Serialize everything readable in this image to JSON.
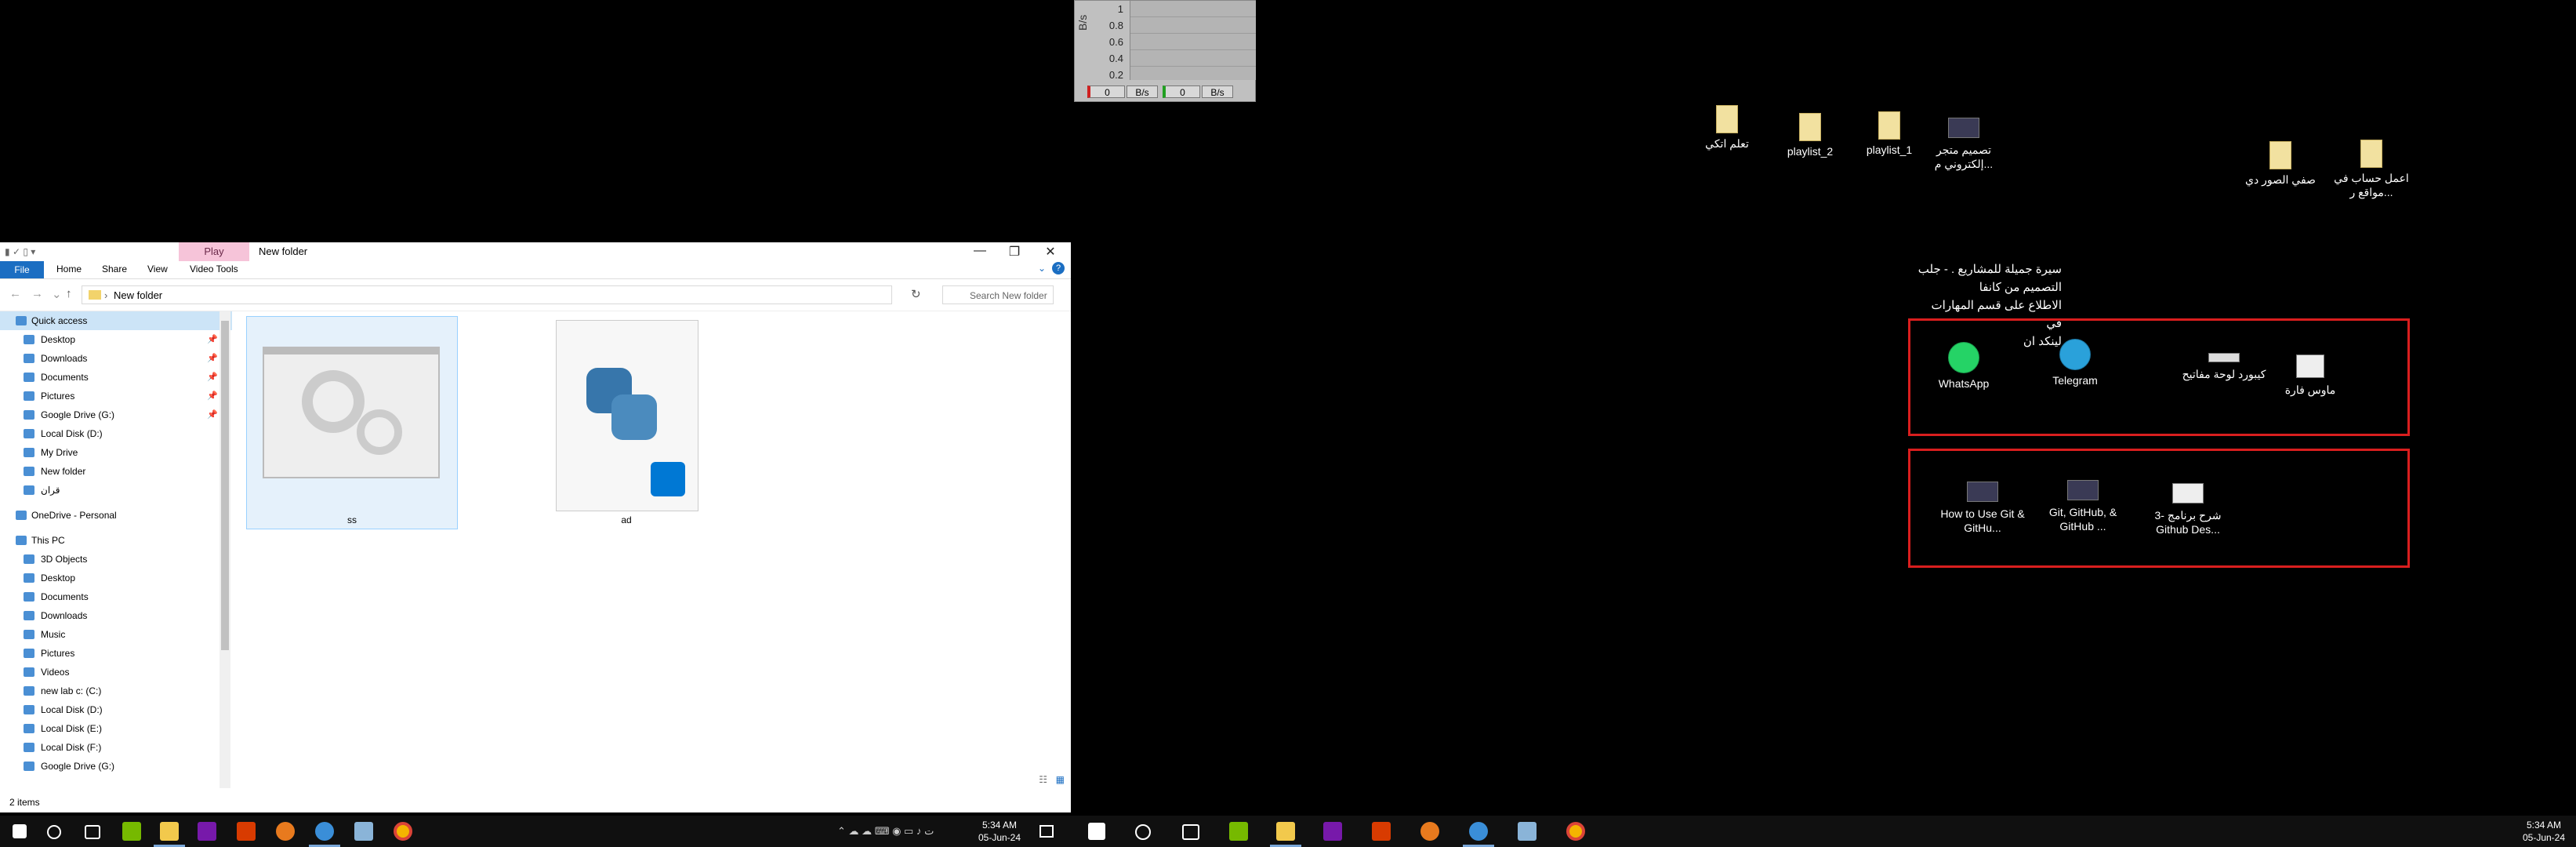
{
  "meter": {
    "unit": "B/s",
    "ticks": [
      "1",
      "0.8",
      "0.6",
      "0.4",
      "0.2"
    ],
    "down_value": "0",
    "down_unit": "B/s",
    "up_value": "0",
    "up_unit": "B/s"
  },
  "desktop_icons": [
    {
      "label": "تعلم اتكي",
      "icon": "folder-zip-icon"
    },
    {
      "label": "playlist_2",
      "icon": "folder-icon"
    },
    {
      "label": "playlist_1",
      "icon": "folder-icon"
    },
    {
      "label": "تصميم متجر إلكتروني م...",
      "icon": "image-icon"
    },
    {
      "label": "صفي الصور دي",
      "icon": "folder-zip-icon"
    },
    {
      "label": "اعمل حساب في مواقع ر...",
      "icon": "folder-zip-icon"
    }
  ],
  "desktop_note": {
    "lines": [
      "سيرة جميلة للمشاريع . - جلب",
      "التصميم من كانفا",
      "الاطلاع على قسم المهارات في",
      "لينكد ان"
    ]
  },
  "box1_icons": [
    {
      "label": "WhatsApp",
      "icon": "whatsapp-icon",
      "color": "#25d366"
    },
    {
      "label": "Telegram",
      "icon": "telegram-icon",
      "color": "#2aa1da"
    },
    {
      "label": "كيبورد لوحة مفاتيح",
      "icon": "keyboard-image-icon"
    },
    {
      "label": "ماوس فارة",
      "icon": "mouse-image-icon"
    }
  ],
  "box2_icons": [
    {
      "label": "How to Use Git & GitHu...",
      "icon": "video-thumb-icon"
    },
    {
      "label": "Git, GitHub, & GitHub ...",
      "icon": "video-thumb-icon"
    },
    {
      "label": "شرح برنامج -3 Github Des...",
      "icon": "video-thumb-icon"
    }
  ],
  "explorer": {
    "title": "New folder",
    "context_tab": "Play",
    "ribbon_tabs": [
      "File",
      "Home",
      "Share",
      "View",
      "Video Tools"
    ],
    "path": "New folder",
    "search_placeholder": "Search New folder",
    "nav": [
      {
        "label": "Quick access",
        "top": true,
        "sel": true
      },
      {
        "label": "Desktop",
        "pin": true
      },
      {
        "label": "Downloads",
        "pin": true
      },
      {
        "label": "Documents",
        "pin": true
      },
      {
        "label": "Pictures",
        "pin": true
      },
      {
        "label": "Google Drive (G:)",
        "pin": true
      },
      {
        "label": "Local Disk (D:)"
      },
      {
        "label": "My Drive"
      },
      {
        "label": "New folder"
      },
      {
        "label": "قران"
      },
      {
        "label": "OneDrive - Personal",
        "top": true
      },
      {
        "label": "This PC",
        "top": true
      },
      {
        "label": "3D Objects"
      },
      {
        "label": "Desktop"
      },
      {
        "label": "Documents"
      },
      {
        "label": "Downloads"
      },
      {
        "label": "Music"
      },
      {
        "label": "Pictures"
      },
      {
        "label": "Videos"
      },
      {
        "label": "new lab c: (C:)"
      },
      {
        "label": "Local Disk (D:)"
      },
      {
        "label": "Local Disk (E:)"
      },
      {
        "label": "Local Disk (F:)"
      },
      {
        "label": "Google Drive (G:)"
      }
    ],
    "files": [
      {
        "name": "ss",
        "icon": "settings-window-icon"
      },
      {
        "name": "ad",
        "icon": "python-file-icon"
      }
    ],
    "status": "2 items"
  },
  "taskbar_left": {
    "time": "5:34 AM",
    "date": "05-Jun-24"
  },
  "taskbar_right": {
    "time": "5:34 AM",
    "date": "05-Jun-24"
  }
}
